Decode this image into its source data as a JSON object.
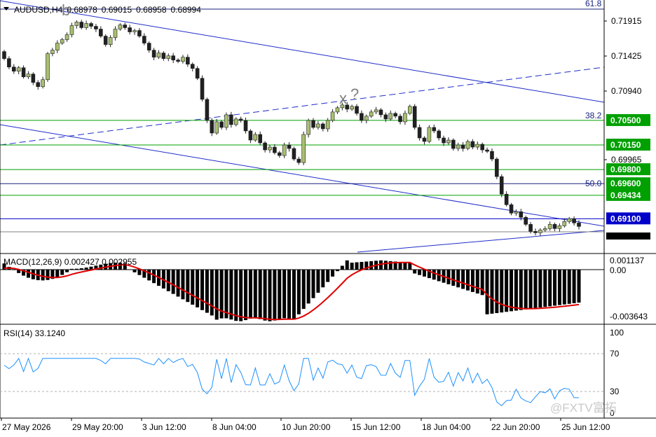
{
  "header": {
    "symbol": "AUDUSD,H4",
    "open": "0.68978",
    "high": "0.69015",
    "low": "0.68958",
    "close": "0.68994"
  },
  "price_axis": [
    "0.71915",
    "0.71425",
    "0.70940",
    "0.69965"
  ],
  "fib_labels": [
    "61.8",
    "38.2",
    "50.0"
  ],
  "wave_labels": [
    "b",
    "x",
    "?"
  ],
  "levels": [
    {
      "price": "0.70500",
      "color": "#00a000"
    },
    {
      "price": "0.70150",
      "color": "#00a000"
    },
    {
      "price": "0.69800",
      "color": "#00a000"
    },
    {
      "price": "0.69600",
      "color": "#1a237e"
    },
    {
      "price": "0.69434",
      "color": "#00a000"
    },
    {
      "price": "0.69100",
      "color": "#0000c8"
    }
  ],
  "current_price_partial": "0.68994",
  "macd": {
    "title": "MACD(12,26,9) 0.002427 0.002955",
    "axis": [
      "0.001137",
      "0.00",
      "-0.003643"
    ]
  },
  "rsi": {
    "title": "RSI(14) 33.1240",
    "axis": [
      "100",
      "70",
      "30",
      "0"
    ]
  },
  "time_axis": [
    "27 May 2026",
    "29 May 20:00",
    "3 Jun 12:00",
    "8 Jun 04:00",
    "10 Jun 20:00",
    "15 Jun 12:00",
    "18 Jun 04:00",
    "22 Jun 20:00",
    "25 Jun 12:00"
  ],
  "watermark": "@FXTV富拓",
  "colors": {
    "bull": "#a8c070",
    "bear": "#202020",
    "trend": "#1f2dc8",
    "support": "#00a000",
    "macd_signal": "#e00000",
    "rsi_line": "#1e90ff"
  }
}
